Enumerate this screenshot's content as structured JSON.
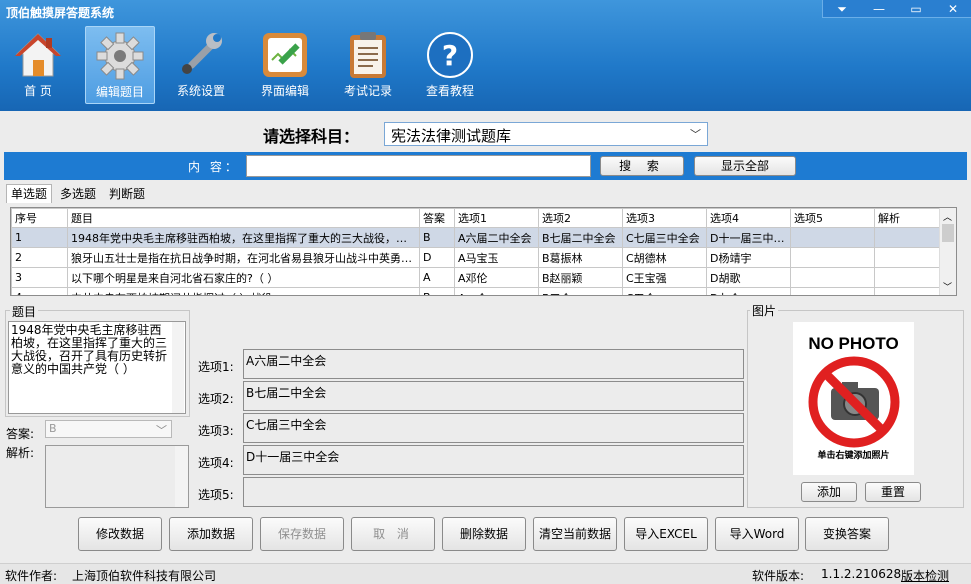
{
  "app": {
    "title": "顶伯触摸屏答题系统"
  },
  "window_controls": [
    {
      "icon": "dropdown-arrow-icon",
      "glyph": "⏷"
    },
    {
      "icon": "minimize-icon",
      "glyph": "—"
    },
    {
      "icon": "maximize-icon",
      "glyph": "▭"
    },
    {
      "icon": "close-icon",
      "glyph": "✕"
    }
  ],
  "toolbar": [
    {
      "label": "首 页",
      "icon": "home-icon",
      "active": false
    },
    {
      "label": "编辑题目",
      "icon": "gear-icon",
      "active": true
    },
    {
      "label": "系统设置",
      "icon": "wrench-icon",
      "active": false
    },
    {
      "label": "界面编辑",
      "icon": "edit-board-icon",
      "active": false
    },
    {
      "label": "考试记录",
      "icon": "clipboard-icon",
      "active": false
    },
    {
      "label": "查看教程",
      "icon": "help-icon",
      "active": false
    }
  ],
  "subject": {
    "label": "请选择科目：",
    "selected": "宪法法律测试题库"
  },
  "search": {
    "label": "内  容：",
    "value": "",
    "search_button": "搜  索",
    "show_all_button": "显示全部"
  },
  "tabs": [
    "单选题",
    "多选题",
    "判断题"
  ],
  "table": {
    "columns": [
      "序号",
      "题目",
      "答案",
      "选项1",
      "选项2",
      "选项3",
      "选项4",
      "选项5",
      "解析"
    ],
    "rows": [
      [
        "1",
        "1948年党中央毛主席移驻西柏坡，在这里指挥了重大的三大战役，召开了具有历史转折意义的中国共产党（ ）",
        "B",
        "A六届二中全会",
        "B七届二中全会",
        "C七届三中全会",
        "D十一届三中全会",
        "",
        ""
      ],
      [
        "2",
        "狼牙山五壮士是指在抗日战争时期，在河北省易县狼牙山战斗中英勇抗击日寇的八路军五位英雄",
        "D",
        "A马宝玉",
        "B葛振林",
        "C胡德林",
        "D杨靖宇",
        "",
        ""
      ],
      [
        "3",
        "以下哪个明星是来自河北省石家庄的?（   ）",
        "A",
        "A邓伦",
        "B赵丽颖",
        "C王宝强",
        "D胡歌",
        "",
        ""
      ],
      [
        "4",
        "中共中央在西柏坡期间共指挥过（  ）战役",
        "B",
        "A一个",
        "B三个",
        "C五个",
        "D七个",
        "",
        ""
      ]
    ],
    "selected_row": 0
  },
  "question": {
    "group_label": "题目",
    "text": "1948年党中央毛主席移驻西柏坡，在这里指挥了重大的三大战役，召开了具有历史转折意义的中国共产党（   ）"
  },
  "answer": {
    "label": "答案:",
    "value": "B"
  },
  "analysis": {
    "label": "解析:",
    "value": ""
  },
  "options": [
    {
      "label": "选项1:",
      "value": "A六届二中全会"
    },
    {
      "label": "选项2:",
      "value": "B七届二中全会"
    },
    {
      "label": "选项3:",
      "value": "C七届三中全会"
    },
    {
      "label": "选项4:",
      "value": "D十一届三中全会"
    },
    {
      "label": "选项5:",
      "value": ""
    }
  ],
  "picture": {
    "group_label": "图片",
    "no_photo": "NO PHOTO",
    "hint": "单击右键添加照片",
    "add_button": "添加",
    "reset_button": "重置"
  },
  "actions": [
    {
      "label": "修改数据",
      "enabled": true
    },
    {
      "label": "添加数据",
      "enabled": true
    },
    {
      "label": "保存数据",
      "enabled": false
    },
    {
      "label": "取  消",
      "enabled": false
    },
    {
      "label": "删除数据",
      "enabled": true
    },
    {
      "label": "清空当前数据",
      "enabled": true
    },
    {
      "label": "导入EXCEL",
      "enabled": true
    },
    {
      "label": "导入Word",
      "enabled": true
    },
    {
      "label": "变换答案",
      "enabled": true
    }
  ],
  "status": {
    "author_label": "软件作者:",
    "author": "上海顶伯软件科技有限公司",
    "version_label": "软件版本:",
    "version": "1.1.2.210628",
    "check_link": "版本检测"
  },
  "colors": {
    "toolbar_bg": "#2079c9",
    "search_bar": "#1e7bd2",
    "selected_row": "#cfd8e6",
    "no_photo_red": "#e02020"
  }
}
